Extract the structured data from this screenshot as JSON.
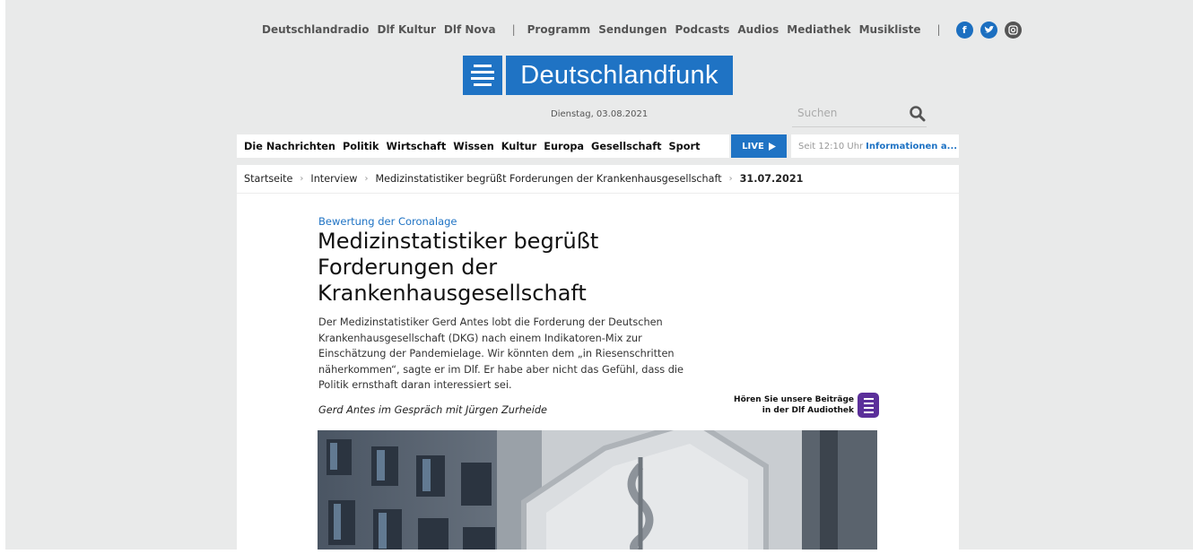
{
  "topbar": {
    "items": [
      "Deutschlandradio",
      "Dlf Kultur",
      "Dlf Nova"
    ],
    "separator": "|",
    "items2": [
      "Programm",
      "Sendungen",
      "Podcasts",
      "Audios",
      "Mediathek",
      "Musikliste"
    ],
    "separator2": "|",
    "social_icons": [
      "facebook-icon",
      "twitter-icon",
      "instagram-icon"
    ]
  },
  "logo": {
    "text": "Deutschlandfunk",
    "color": "#1f73c4"
  },
  "date": "Dienstag, 03.08.2021",
  "search": {
    "placeholder": "Suchen"
  },
  "nav": {
    "items": [
      "Die Nachrichten",
      "Politik",
      "Wirtschaft",
      "Wissen",
      "Kultur",
      "Europa",
      "Gesellschaft",
      "Sport"
    ]
  },
  "live": {
    "label": "LIVE"
  },
  "ticker": {
    "time": "Seit 12:10 Uhr",
    "title": "Informationen a..."
  },
  "breadcrumb": {
    "items": [
      "Startseite",
      "Interview",
      "Medizinstatistiker begrüßt Forderungen der Krankenhausgesellschaft",
      "31.07.2021"
    ]
  },
  "article": {
    "kicker": "Bewertung der Coronalage",
    "headline": "Medizinstatistiker begrüßt Forderungen der Krankenhausgesellschaft",
    "teaser": "Der Medizinstatistiker Gerd Antes lobt die Forderung der Deutschen Krankenhausgesellschaft (DKG) nach einem Indikatoren-Mix zur Einschätzung der Pandemielage. Wir könnten dem „in Riesenschritten näherkommen“, sagte er im Dlf. Er habe aber nicht das Gefühl, dass die Politik ernsthaft daran interessiert sei.",
    "author": "Gerd Antes im Gespräch mit Jürgen Zurheide"
  },
  "audiothek": {
    "line1": "Hören Sie unsere Beiträge",
    "line2": "in der Dlf Audiothek"
  },
  "colors": {
    "accent": "#1f73c4",
    "background": "#e9eaea",
    "audiothek": "#5b2f9a"
  }
}
